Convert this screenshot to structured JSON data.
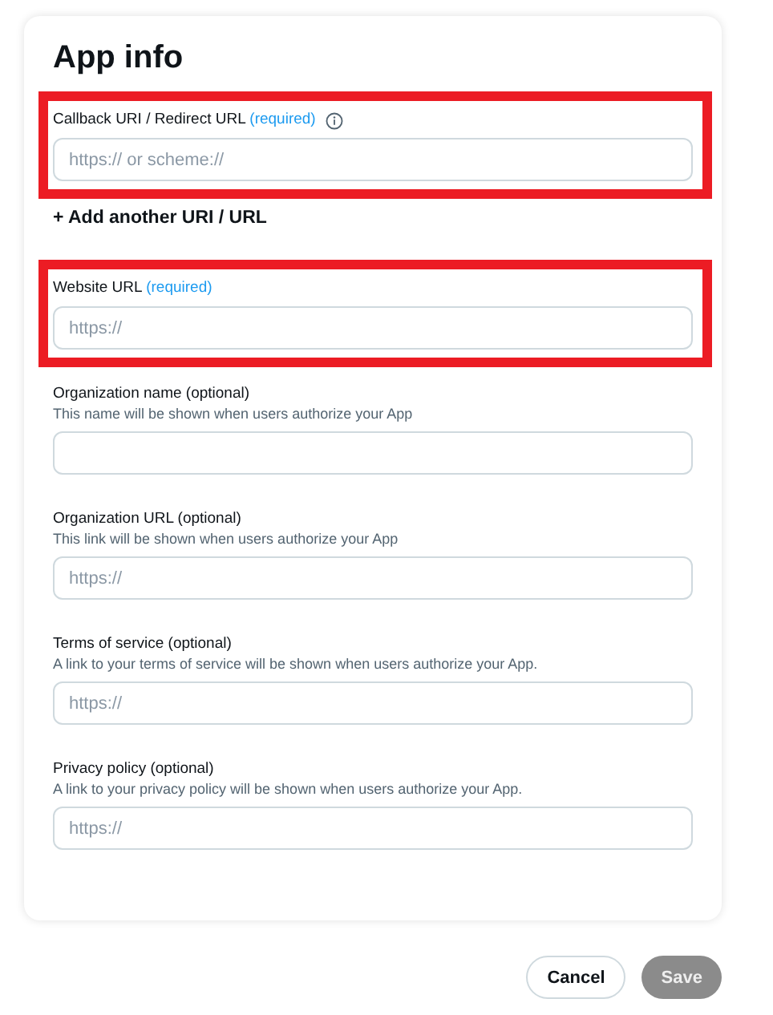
{
  "title": "App info",
  "fields": [
    {
      "label": "Callback URI / Redirect URL",
      "tag": "(required)",
      "required": true,
      "info": true,
      "placeholder": "https:// or scheme://",
      "highlighted": true
    },
    {
      "kind": "link",
      "label": "+ Add another URI / URL"
    },
    {
      "label": "Website URL",
      "tag": "(required)",
      "required": true,
      "info": false,
      "placeholder": "https://",
      "highlighted": true
    },
    {
      "label": "Organization name",
      "tag": "(optional)",
      "required": false,
      "info": false,
      "hint": "This name will be shown when users authorize your App",
      "highlighted": false
    },
    {
      "label": "Organization URL",
      "tag": "(optional)",
      "required": false,
      "info": false,
      "hint": "This link will be shown when users authorize your App",
      "placeholder": "https://",
      "highlighted": false
    },
    {
      "label": "Terms of service",
      "tag": "(optional)",
      "required": false,
      "info": false,
      "hint": "A link to your terms of service will be shown when users authorize your App.",
      "placeholder": "https://",
      "highlighted": false
    },
    {
      "label": "Privacy policy",
      "tag": "(optional)",
      "required": false,
      "info": false,
      "hint": "A link to your privacy policy will be shown when users authorize your App.",
      "placeholder": "https://",
      "highlighted": false
    }
  ],
  "buttons": [
    {
      "label": "Cancel",
      "kind": "secondary",
      "disabled": false
    },
    {
      "label": "Save",
      "kind": "primary",
      "disabled": true
    }
  ]
}
